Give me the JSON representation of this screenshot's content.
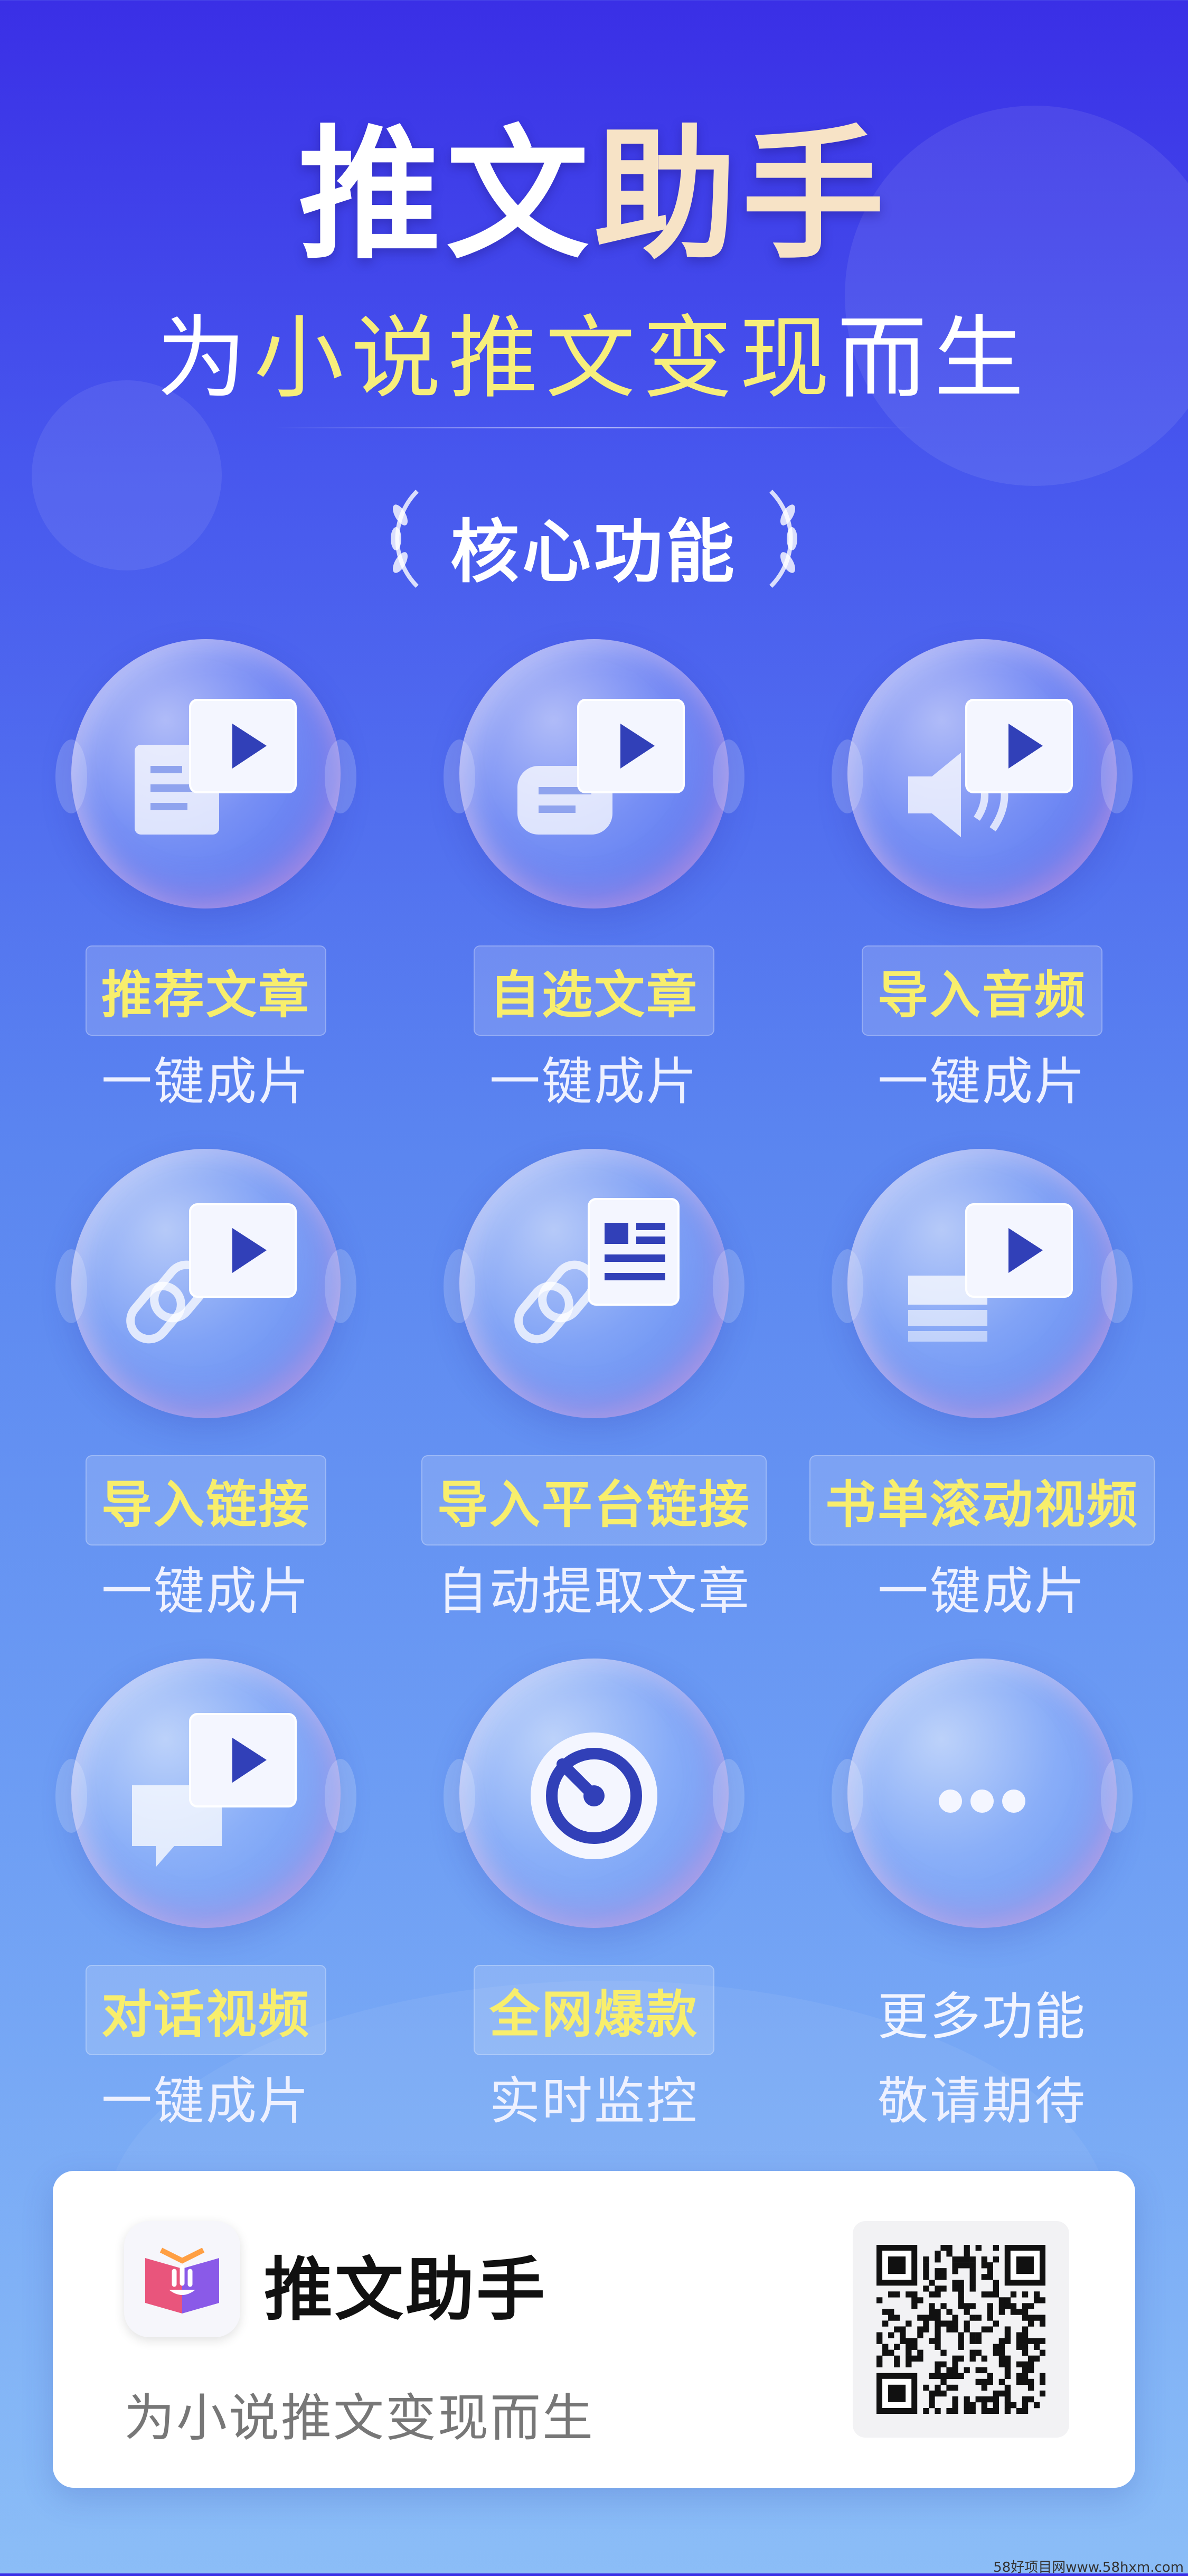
{
  "header": {
    "title_part1": "推文",
    "title_part2": "助手",
    "subtitle_1": "为",
    "subtitle_2": "小说推文变现",
    "subtitle_3": "而生"
  },
  "section": {
    "title": "核心功能"
  },
  "features": [
    {
      "label": "推荐文章",
      "sub": "一键成片",
      "icon": "article-video-icon"
    },
    {
      "label": "自选文章",
      "sub": "一键成片",
      "icon": "scroll-video-icon"
    },
    {
      "label": "导入音频",
      "sub": "一键成片",
      "icon": "audio-video-icon"
    },
    {
      "label": "导入链接",
      "sub": "一键成片",
      "icon": "link-video-icon"
    },
    {
      "label": "导入平台链接",
      "sub": "自动提取文章",
      "icon": "link-article-icon"
    },
    {
      "label": "书单滚动视频",
      "sub": "一键成片",
      "icon": "booklist-video-icon"
    },
    {
      "label": "对话视频",
      "sub": "一键成片",
      "icon": "chat-video-icon"
    },
    {
      "label": "全网爆款",
      "sub": "实时监控",
      "icon": "monitor-target-icon"
    },
    {
      "label": "更多功能",
      "sub": "敬请期待",
      "icon": "more-dots-icon"
    }
  ],
  "card": {
    "app_name": "推文助手",
    "slogan": "为小说推文变现而生",
    "app_icon": "book-hand-icon",
    "qr": "qr-code"
  },
  "footer": {
    "credit": "58好项目网www.58hxm.com"
  },
  "colors": {
    "highlight": "#f8ee6c",
    "bg_top": "#3a2fe6",
    "bg_bottom": "#8bbdf7"
  }
}
